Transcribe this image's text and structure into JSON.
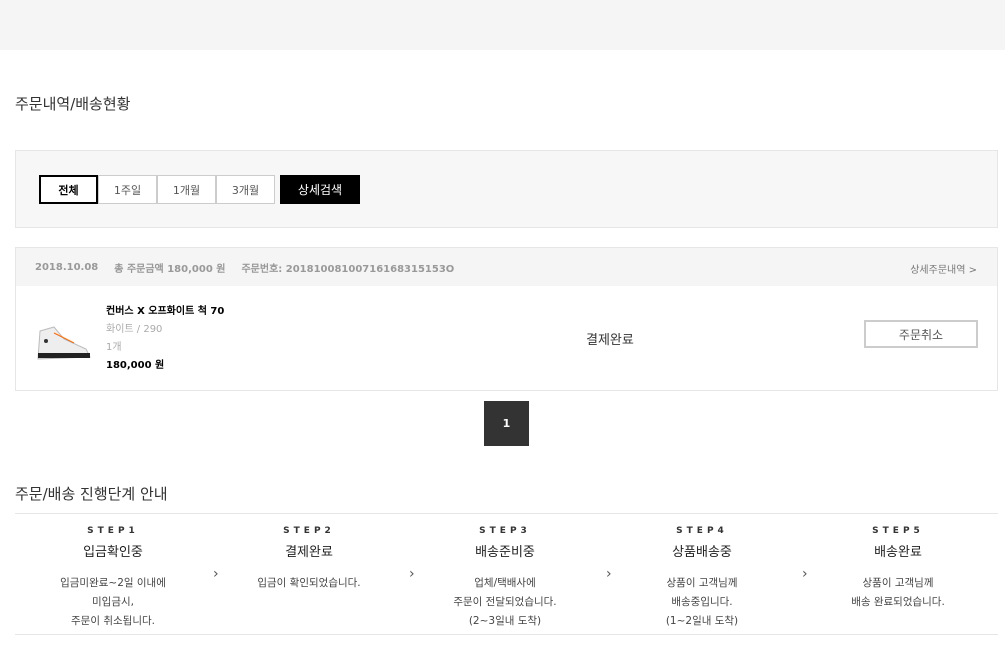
{
  "title": "주문내역/배송현황",
  "filters": [
    "전체",
    "1주일",
    "1개월",
    "3개월"
  ],
  "search_label": "상세검색",
  "order": {
    "date": "2018.10.08",
    "total": "총 주문금액 180,000 원",
    "number": "주문번호: 20181008100716168315153O",
    "detail_link": "상세주문내역 >",
    "product": {
      "name": "컨버스 X 오프화이트 척 70",
      "option": "화이트 / 290",
      "qty": "1개",
      "price": "180,000 원"
    },
    "status": "결제완료",
    "cancel_label": "주문취소"
  },
  "pagination": {
    "current": "1"
  },
  "guide_title": "주문/배송 진행단계 안내",
  "steps": [
    {
      "key": "STEP1",
      "title": "입금확인중",
      "desc": "입금미완료~2일 이내에\n미입금시,\n주문이 취소됩니다."
    },
    {
      "key": "STEP2",
      "title": "결제완료",
      "desc": "입금이 확인되었습니다."
    },
    {
      "key": "STEP3",
      "title": "배송준비중",
      "desc": "업체/택배사에\n주문이 전달되었습니다.\n(2~3일내 도착)"
    },
    {
      "key": "STEP4",
      "title": "상품배송중",
      "desc": "상품이 고객님께\n배송중입니다.\n(1~2일내 도착)"
    },
    {
      "key": "STEP5",
      "title": "배송완료",
      "desc": "상품이 고객님께\n배송 완료되었습니다."
    }
  ]
}
